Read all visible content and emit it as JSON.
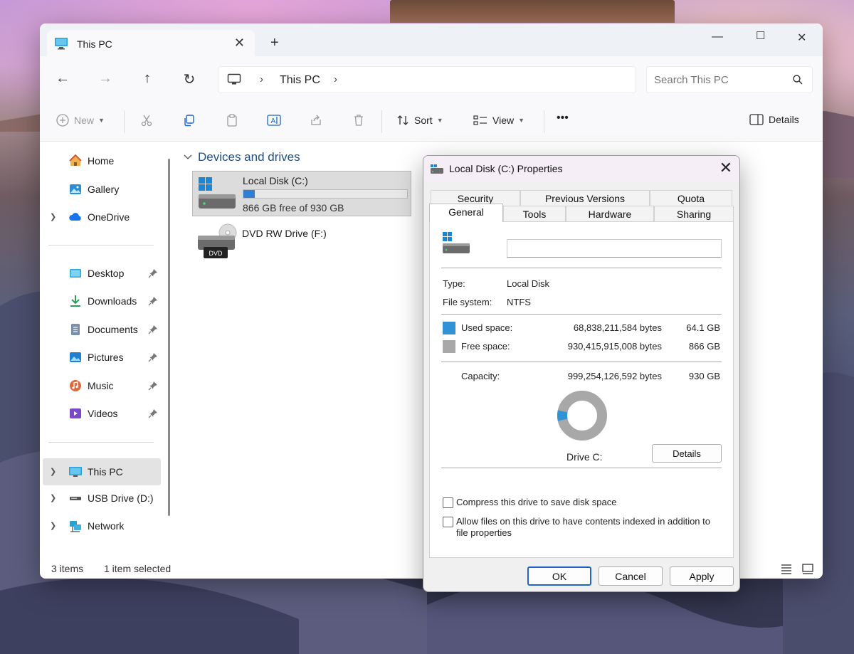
{
  "explorer": {
    "tab_title": "This PC",
    "address": {
      "crumb": "This PC"
    },
    "search": {
      "placeholder": "Search This PC"
    },
    "toolbar": {
      "new_label": "New",
      "sort_label": "Sort",
      "view_label": "View",
      "more_label": "•••",
      "details_label": "Details"
    },
    "sidebar": {
      "top": [
        {
          "label": "Home",
          "icon": "home-icon"
        },
        {
          "label": "Gallery",
          "icon": "gallery-icon"
        },
        {
          "label": "OneDrive",
          "icon": "cloud-icon"
        }
      ],
      "quick": [
        {
          "label": "Desktop",
          "icon": "desktop-folder-icon"
        },
        {
          "label": "Downloads",
          "icon": "download-icon"
        },
        {
          "label": "Documents",
          "icon": "document-icon"
        },
        {
          "label": "Pictures",
          "icon": "pictures-icon"
        },
        {
          "label": "Music",
          "icon": "music-icon"
        },
        {
          "label": "Videos",
          "icon": "video-icon"
        }
      ],
      "bottom": [
        {
          "label": "This PC",
          "icon": "computer-icon"
        },
        {
          "label": "USB Drive (D:)",
          "icon": "usb-drive-icon"
        },
        {
          "label": "Network",
          "icon": "network-icon"
        }
      ]
    },
    "content": {
      "group_title": "Devices and drives",
      "drives": [
        {
          "name": "Local Disk (C:)",
          "free_text": "866 GB free of 930 GB",
          "used_fraction": 0.069
        },
        {
          "name": "DVD RW Drive (F:)",
          "badge": "DVD"
        }
      ]
    },
    "status": {
      "items": "3 items",
      "selected": "1 item selected"
    }
  },
  "dialog": {
    "title": "Local Disk (C:) Properties",
    "tabs_top": [
      "Security",
      "Previous Versions",
      "Quota"
    ],
    "tabs_bottom": [
      "General",
      "Tools",
      "Hardware",
      "Sharing"
    ],
    "name_value": "",
    "type_label": "Type:",
    "type_value": "Local Disk",
    "fs_label": "File system:",
    "fs_value": "NTFS",
    "used_label": "Used space:",
    "used_bytes": "68,838,211,584 bytes",
    "used_gb": "64.1 GB",
    "free_label": "Free space:",
    "free_bytes": "930,415,915,008 bytes",
    "free_gb": "866 GB",
    "cap_label": "Capacity:",
    "cap_bytes": "999,254,126,592 bytes",
    "cap_gb": "930 GB",
    "drive_label": "Drive C:",
    "details_button": "Details",
    "compress_label": "Compress this drive to save disk space",
    "index_label": "Allow files on this drive to have contents indexed in addition to file properties",
    "ok": "OK",
    "cancel": "Cancel",
    "apply": "Apply",
    "used_fraction": 0.069,
    "colors": {
      "used": "#2f93d6",
      "free": "#a8a8a8"
    }
  }
}
